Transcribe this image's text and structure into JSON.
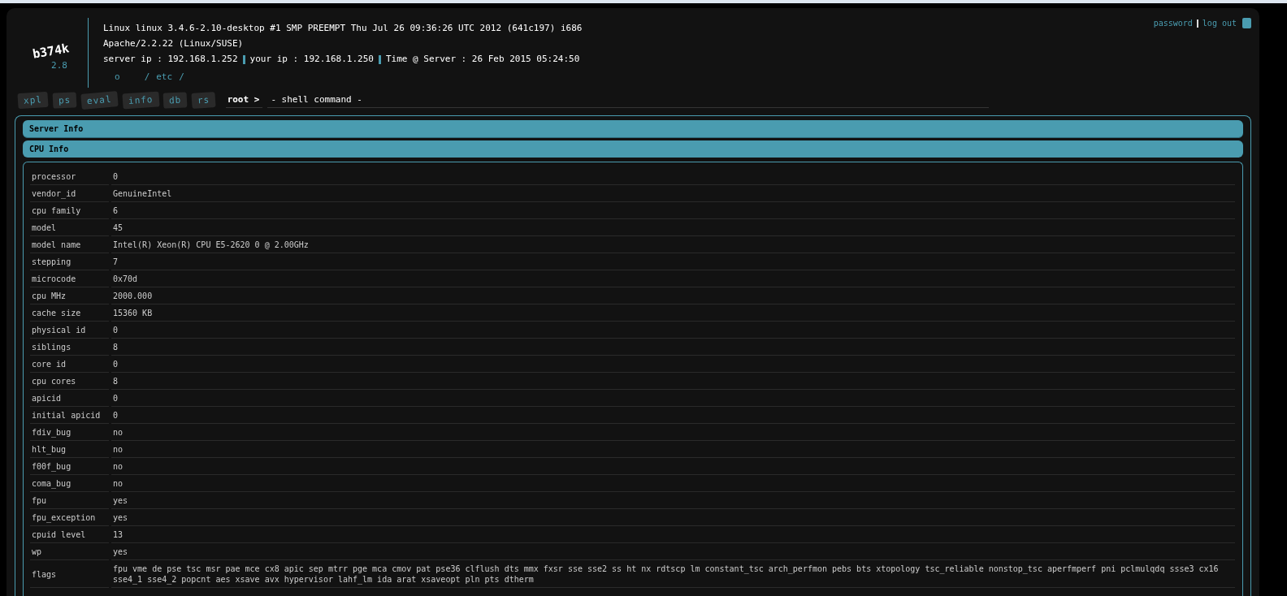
{
  "logo": {
    "name": "b374k",
    "version": "2.8"
  },
  "system_info": [
    "Linux linux 3.4.6-2.10-desktop #1 SMP PREEMPT Thu Jul 26 09:36:26 UTC 2012 (641c197) i686",
    "Apache/2.2.22 (Linux/SUSE)"
  ],
  "address_line": [
    {
      "label": "server ip : 192.168.1.252"
    },
    {
      "label": "your ip : 192.168.1.250"
    },
    {
      "label": "Time @ Server : 26 Feb 2015 05:24:50"
    }
  ],
  "path": [
    "o",
    "/",
    "etc",
    "/"
  ],
  "account_links": [
    "password",
    "log out"
  ],
  "tabs": [
    {
      "label": "xpl"
    },
    {
      "label": "ps"
    },
    {
      "label": "eval"
    },
    {
      "label": "info"
    },
    {
      "label": "db"
    },
    {
      "label": "rs"
    }
  ],
  "prompt": {
    "user": "root >",
    "placeholder": "- shell command -"
  },
  "sections": [
    {
      "title": "Server Info",
      "expanded": false
    },
    {
      "title": "CPU Info",
      "expanded": true
    }
  ],
  "cpu_info": [
    {
      "key": "processor",
      "value": "0"
    },
    {
      "key": "vendor_id",
      "value": "GenuineIntel"
    },
    {
      "key": "cpu family",
      "value": "6"
    },
    {
      "key": "model",
      "value": "45"
    },
    {
      "key": "model name",
      "value": "Intel(R) Xeon(R) CPU E5-2620 0 @ 2.00GHz"
    },
    {
      "key": "stepping",
      "value": "7"
    },
    {
      "key": "microcode",
      "value": "0x70d"
    },
    {
      "key": "cpu MHz",
      "value": "2000.000"
    },
    {
      "key": "cache size",
      "value": "15360 KB"
    },
    {
      "key": "physical id",
      "value": "0"
    },
    {
      "key": "siblings",
      "value": "8"
    },
    {
      "key": "core id",
      "value": "0"
    },
    {
      "key": "cpu cores",
      "value": "8"
    },
    {
      "key": "apicid",
      "value": "0"
    },
    {
      "key": "initial apicid",
      "value": "0"
    },
    {
      "key": "fdiv_bug",
      "value": "no"
    },
    {
      "key": "hlt_bug",
      "value": "no"
    },
    {
      "key": "f00f_bug",
      "value": "no"
    },
    {
      "key": "coma_bug",
      "value": "no"
    },
    {
      "key": "fpu",
      "value": "yes"
    },
    {
      "key": "fpu_exception",
      "value": "yes"
    },
    {
      "key": "cpuid level",
      "value": "13"
    },
    {
      "key": "wp",
      "value": "yes"
    },
    {
      "key": "flags",
      "value": "fpu vme de pse tsc msr pae mce cx8 apic sep mtrr pge mca cmov pat pse36 clflush dts mmx fxsr sse sse2 ss ht nx rdtscp lm constant_tsc arch_perfmon pebs bts xtopology tsc_reliable nonstop_tsc aperfmperf pni pclmulqdq ssse3 cx16 sse4_1 sse4_2 popcnt aes xsave avx hypervisor lahf_lm ida arat xsaveopt pln pts dtherm"
    }
  ]
}
